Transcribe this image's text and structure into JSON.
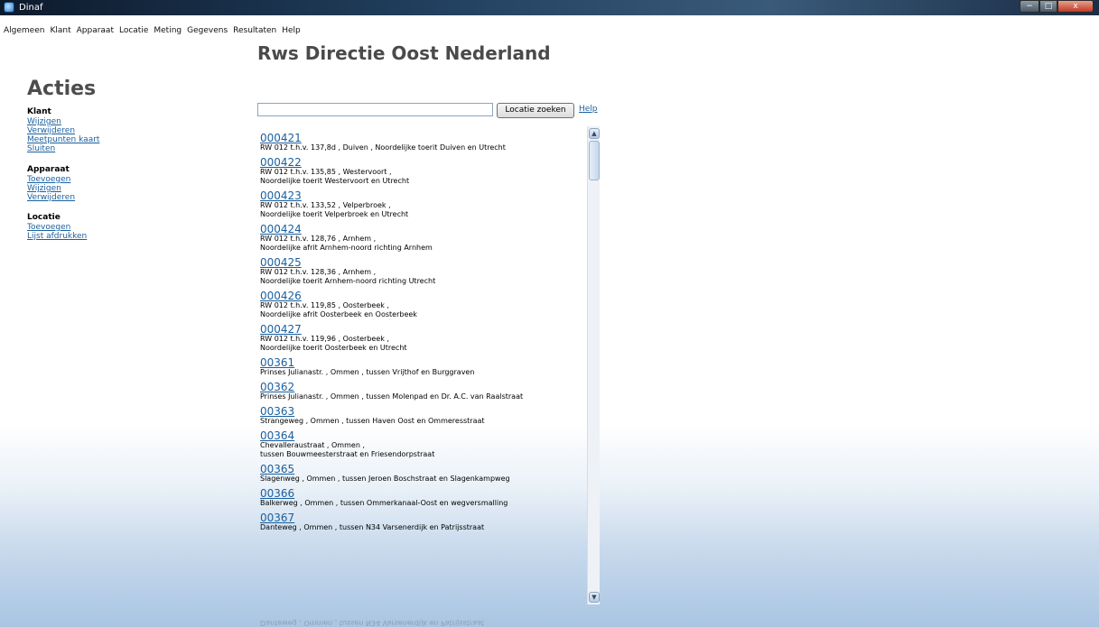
{
  "window": {
    "title": "Dinaf",
    "controls": {
      "minimize": "−",
      "maximize": "□",
      "close": "x"
    }
  },
  "menu": [
    "Algemeen",
    "Klant",
    "Apparaat",
    "Locatie",
    "Meting",
    "Gegevens",
    "Resultaten",
    "Help"
  ],
  "page": {
    "title": "Rws Directie Oost Nederland"
  },
  "sidebar": {
    "title": "Acties",
    "sections": [
      {
        "heading": "Klant",
        "links": [
          "Wijzigen",
          "Verwijderen",
          "Meetpunten kaart",
          "Sluiten"
        ]
      },
      {
        "heading": "Apparaat",
        "links": [
          "Toevoegen",
          "Wijzigen",
          "Verwijderen"
        ]
      },
      {
        "heading": "Locatie",
        "links": [
          "Toevoegen",
          "Lijst afdrukken"
        ]
      }
    ]
  },
  "search": {
    "value": "",
    "button_label": "Locatie zoeken",
    "help_label": "Help"
  },
  "locations": [
    {
      "code": "000421",
      "lines": [
        "RW 012 t.h.v. 137,8d ,  Duiven ,  Noordelijke toerit Duiven en Utrecht"
      ]
    },
    {
      "code": "000422",
      "lines": [
        "RW 012 t.h.v. 135,85 ,  Westervoort ,",
        "Noordelijke toerit Westervoort en Utrecht"
      ]
    },
    {
      "code": "000423",
      "lines": [
        "RW 012 t.h.v. 133,52 ,  Velperbroek ,",
        "Noordelijke toerit Velperbroek en Utrecht"
      ]
    },
    {
      "code": "000424",
      "lines": [
        "RW 012 t.h.v. 128,76 ,  Arnhem ,",
        "Noordelijke afrit Arnhem-noord richting Arnhem"
      ]
    },
    {
      "code": "000425",
      "lines": [
        "RW 012 t.h.v. 128,36 ,  Arnhem ,",
        "Noordelijke toerit Arnhem-noord richting Utrecht"
      ]
    },
    {
      "code": "000426",
      "lines": [
        "RW 012 t.h.v. 119,85 ,  Oosterbeek ,",
        "Noordelijke afrit Oosterbeek en Oosterbeek"
      ]
    },
    {
      "code": "000427",
      "lines": [
        "RW 012 t.h.v. 119,96 ,  Oosterbeek ,",
        "Noordelijke toerit Oosterbeek en Utrecht"
      ]
    },
    {
      "code": "00361",
      "lines": [
        "Prinses Julianastr. ,  Ommen ,  tussen Vrijthof en Burggraven"
      ]
    },
    {
      "code": "00362",
      "lines": [
        "Prinses Julianastr. ,  Ommen ,  tussen Molenpad en Dr. A.C. van Raalstraat"
      ]
    },
    {
      "code": "00363",
      "lines": [
        "Strangeweg ,  Ommen ,  tussen Haven Oost en Ommeresstraat"
      ]
    },
    {
      "code": "00364",
      "lines": [
        "Chevalleraustraat ,  Ommen ,",
        "tussen Bouwmeesterstraat en Friesendorpstraat"
      ]
    },
    {
      "code": "00365",
      "lines": [
        "Slagenweg ,  Ommen ,  tussen Jeroen Boschstraat en Slagenkampweg"
      ]
    },
    {
      "code": "00366",
      "lines": [
        "Balkerweg ,  Ommen ,  tussen Ommerkanaal-Oost en wegversmalling"
      ]
    },
    {
      "code": "00367",
      "lines": [
        "Danteweg ,  Ommen ,  tussen N34 Varsenerdijk en Patrijsstraat"
      ]
    }
  ],
  "scrollbar": {
    "up_arrow": "▲",
    "down_arrow": "▼",
    "position": 0.0
  },
  "icons": [
    "app-icon",
    "scroll-up-arrow-icon",
    "scroll-down-arrow-icon"
  ]
}
